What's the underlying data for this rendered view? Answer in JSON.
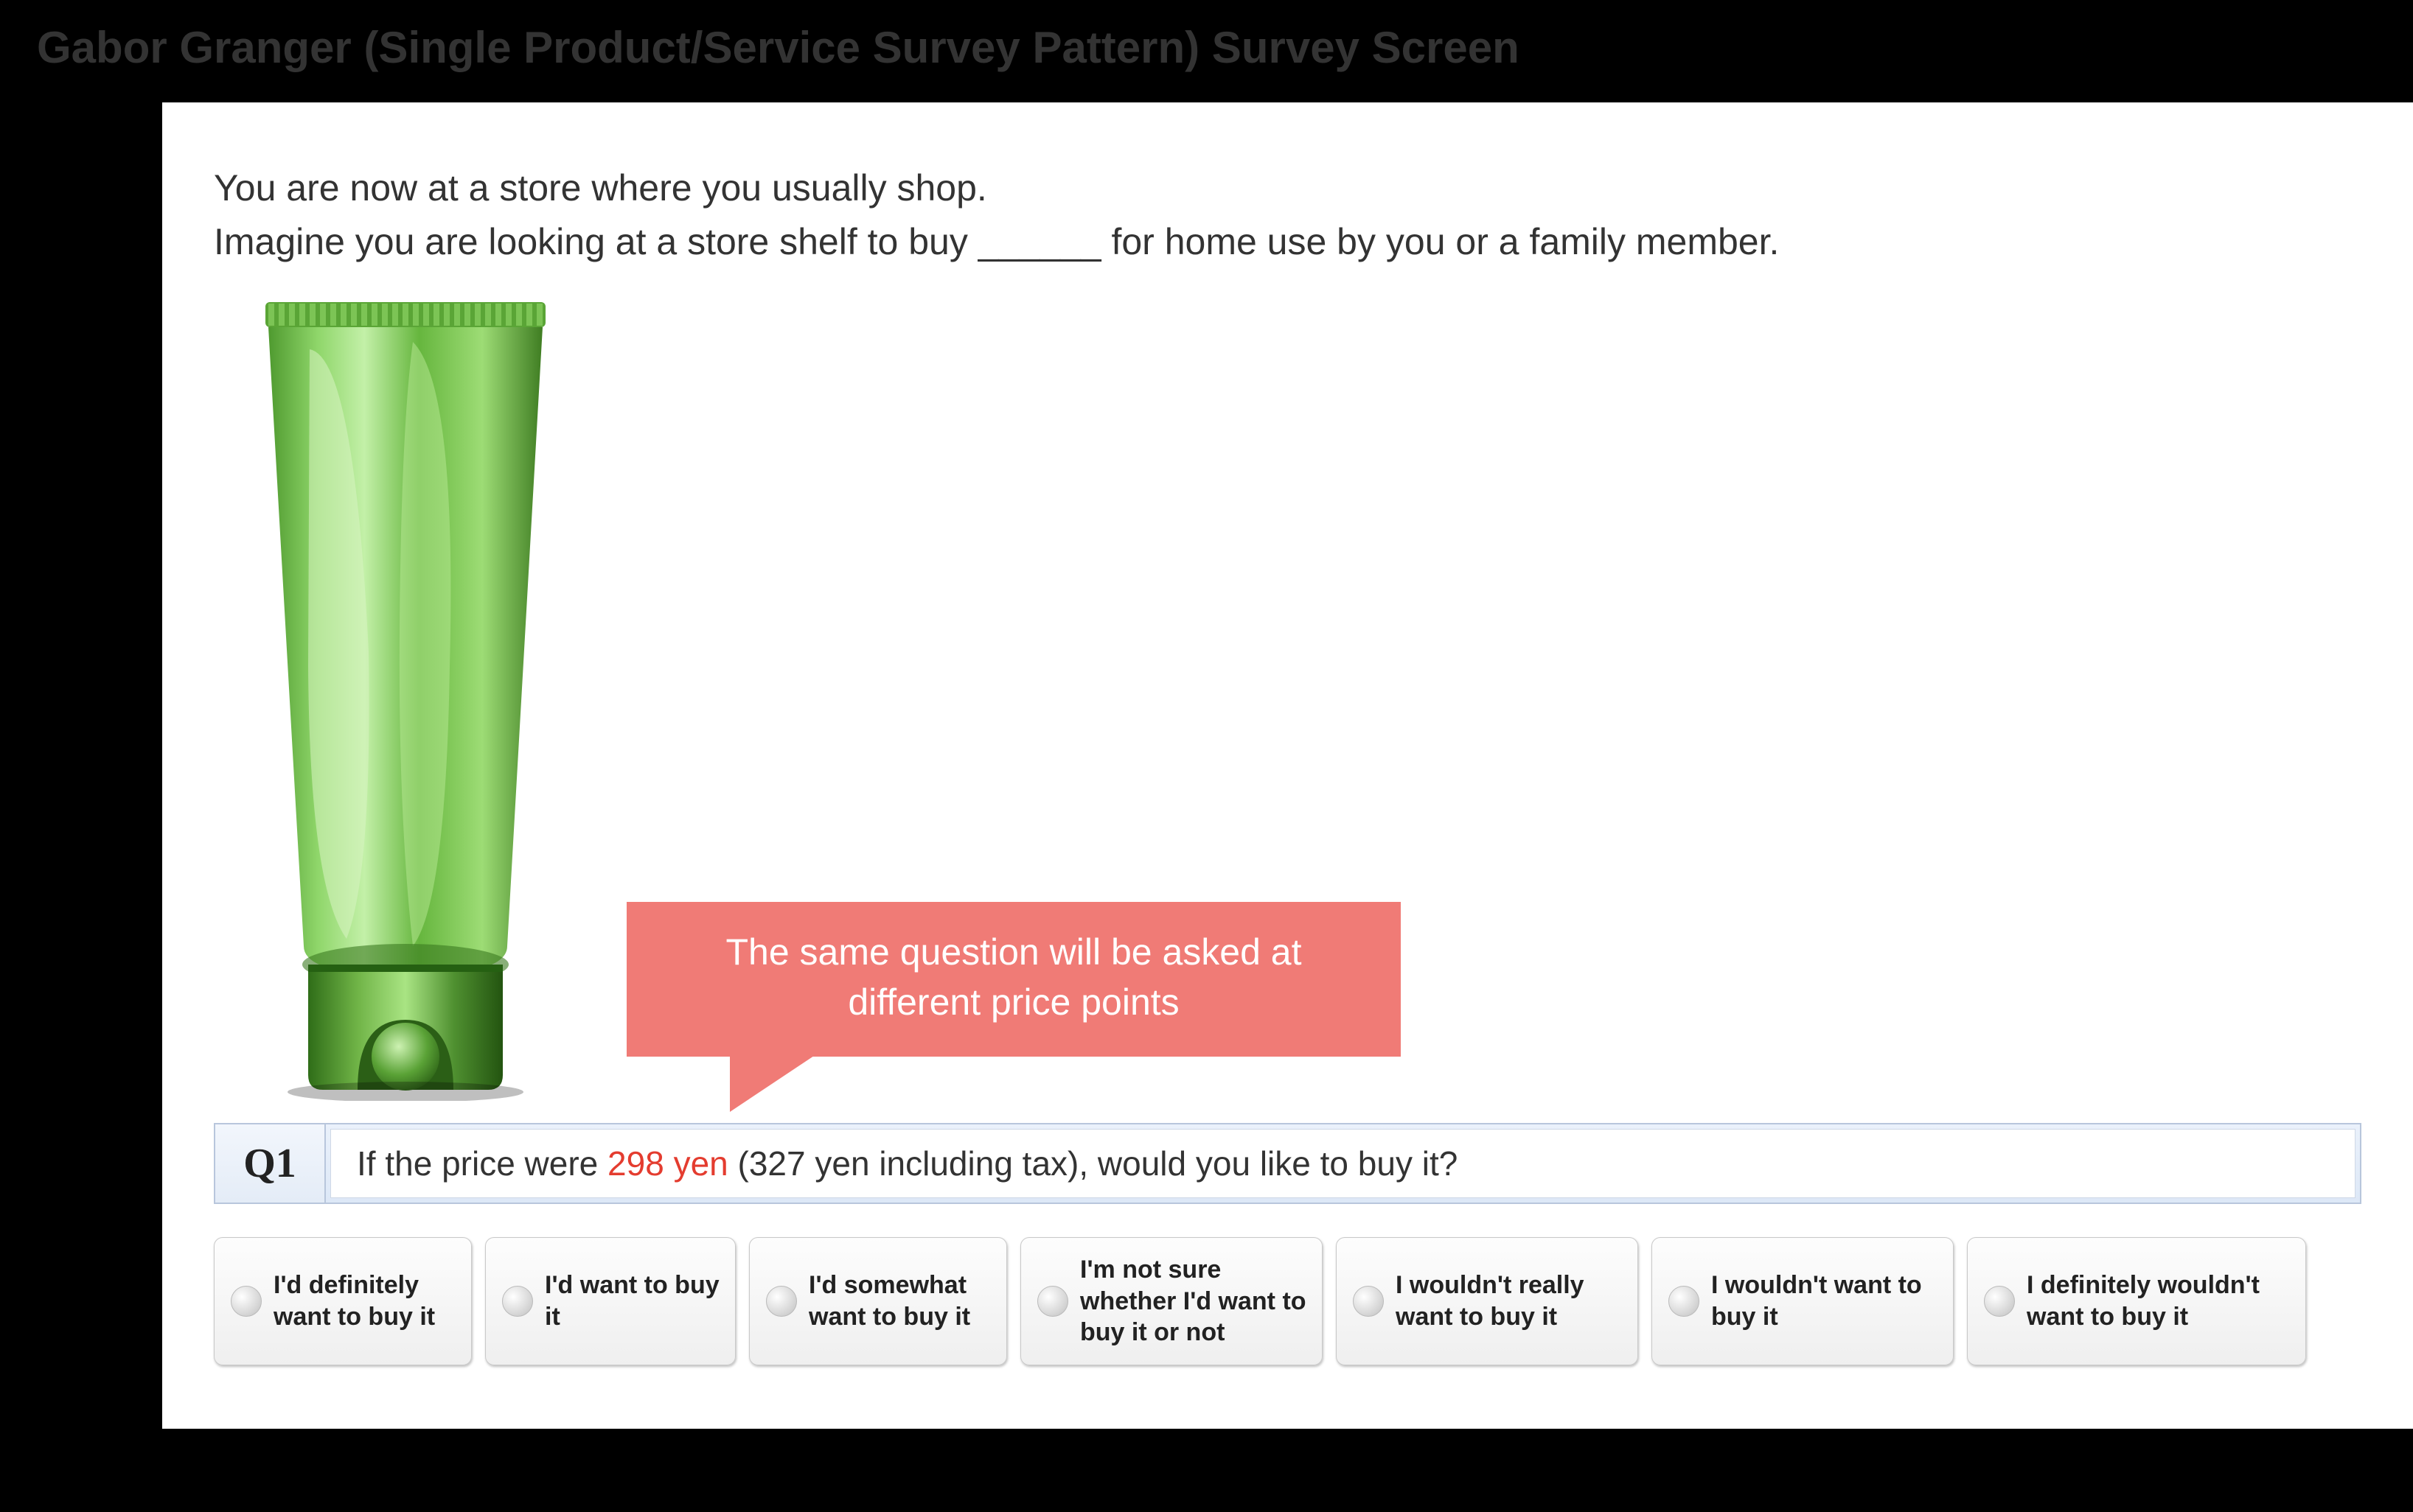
{
  "header": {
    "title": "Gabor Granger (Single Product/Service Survey Pattern) Survey Screen"
  },
  "prompt": {
    "line1": "You are now at a store where you usually shop.",
    "line2_pre": "Imagine you are looking at a store shelf to buy ",
    "blank": "______",
    "line2_post": " for home use by you or a family member."
  },
  "callout": {
    "text": "The same question will be asked at different price points"
  },
  "question": {
    "label": "Q1",
    "text_pre": "If the price were ",
    "price": "298 yen",
    "text_mid": " (327 yen including tax), would you like to buy it?"
  },
  "options": [
    {
      "label": "I'd definitely want to buy it"
    },
    {
      "label": "I'd want to buy it"
    },
    {
      "label": "I'd somewhat want to buy it"
    },
    {
      "label": "I'm not sure whether I'd want to buy it or not"
    },
    {
      "label": "I wouldn't really want to buy it"
    },
    {
      "label": "I wouldn't want to buy it"
    },
    {
      "label": "I definitely wouldn't want to buy it"
    }
  ],
  "product": {
    "name": "green-cosmetic-tube"
  }
}
